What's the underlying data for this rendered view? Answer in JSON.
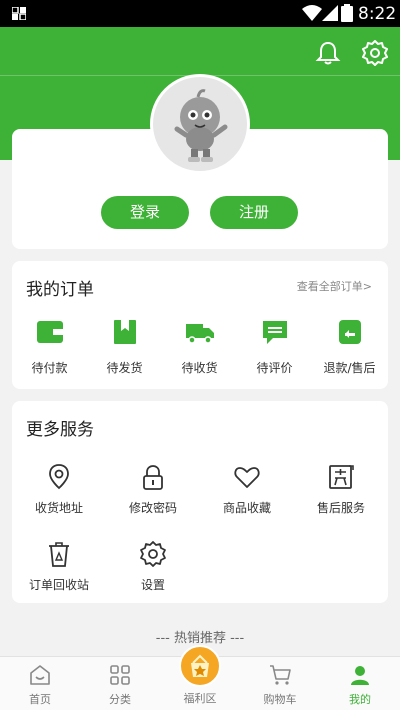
{
  "status_bar": {
    "time": "8:22"
  },
  "auth": {
    "login_label": "登录",
    "register_label": "注册"
  },
  "orders": {
    "title": "我的订单",
    "view_all": "查看全部订单>",
    "items": [
      {
        "label": "待付款",
        "icon": "wallet-icon"
      },
      {
        "label": "待发货",
        "icon": "package-icon"
      },
      {
        "label": "待收货",
        "icon": "truck-icon"
      },
      {
        "label": "待评价",
        "icon": "comment-icon"
      },
      {
        "label": "退款/售后",
        "icon": "refund-icon"
      }
    ]
  },
  "services": {
    "title": "更多服务",
    "items": [
      {
        "label": "收货地址",
        "icon": "location-icon"
      },
      {
        "label": "修改密码",
        "icon": "lock-icon"
      },
      {
        "label": "商品收藏",
        "icon": "heart-icon"
      },
      {
        "label": "售后服务",
        "icon": "after-sales-icon"
      },
      {
        "label": "订单回收站",
        "icon": "recycle-bin-icon"
      },
      {
        "label": "设置",
        "icon": "settings-icon"
      }
    ]
  },
  "hot_sales": {
    "title": "--- 热销推荐 ---"
  },
  "tabs": [
    {
      "label": "首页",
      "icon": "home-icon",
      "active": false
    },
    {
      "label": "分类",
      "icon": "category-icon",
      "active": false
    },
    {
      "label": "福利区",
      "icon": "welfare-icon",
      "active": false
    },
    {
      "label": "购物车",
      "icon": "cart-icon",
      "active": false
    },
    {
      "label": "我的",
      "icon": "profile-icon",
      "active": true
    }
  ],
  "colors": {
    "brand_green": "#3eb137",
    "welfare_orange": "#f5a623"
  }
}
